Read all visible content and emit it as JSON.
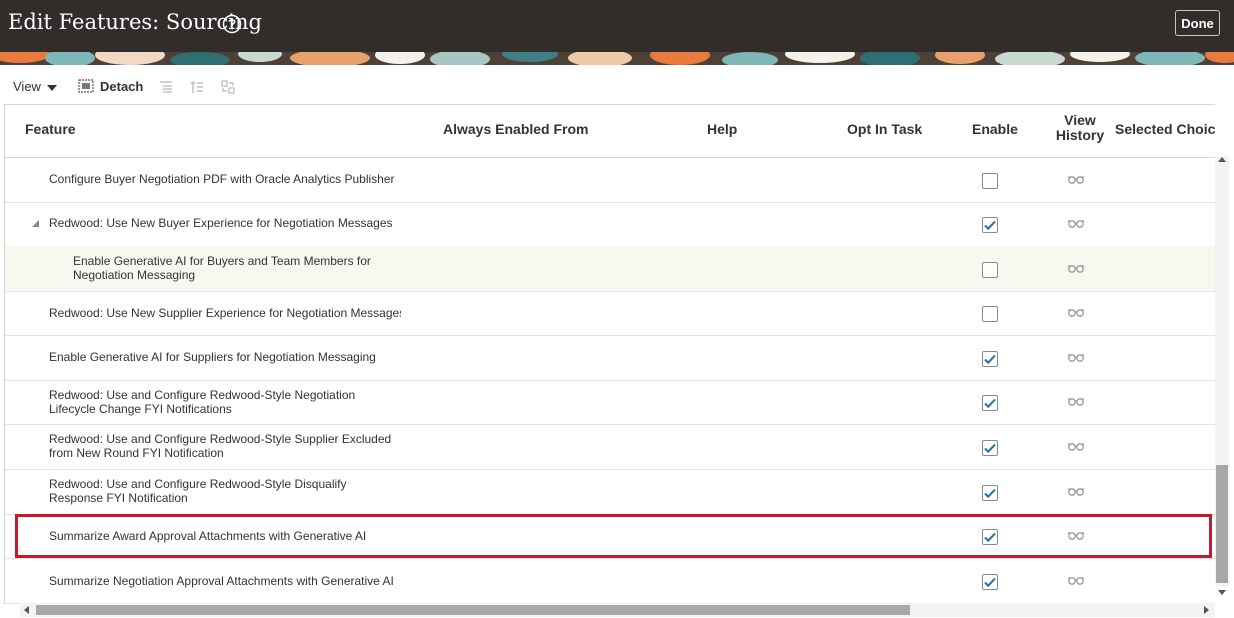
{
  "header": {
    "title": "Edit Features: Sourcing",
    "done_label": "Done"
  },
  "toolbar": {
    "view_label": "View",
    "detach_label": "Detach"
  },
  "table": {
    "columns": [
      "Feature",
      "Always Enabled From",
      "Help",
      "Opt In Task",
      "Enable",
      "View History",
      "Selected Choice"
    ],
    "rows": [
      {
        "feature": "Configure Buyer Negotiation PDF with Oracle Analytics Publisher",
        "enabled": false
      },
      {
        "feature": "Redwood: Use New Buyer Experience for Negotiation Messages",
        "enabled": true,
        "expanded": true
      },
      {
        "feature": "Enable Generative AI for Buyers and Team Members for Negotiation Messaging",
        "enabled": false,
        "child": true
      },
      {
        "feature": "Redwood: Use New Supplier Experience for Negotiation Messages",
        "enabled": false
      },
      {
        "feature": "Enable Generative AI for Suppliers for Negotiation Messaging",
        "enabled": true
      },
      {
        "feature": "Redwood: Use and Configure Redwood-Style Negotiation Lifecycle Change FYI Notifications",
        "enabled": true
      },
      {
        "feature": "Redwood: Use and Configure Redwood-Style Supplier Excluded from New Round FYI Notification",
        "enabled": true
      },
      {
        "feature": "Redwood: Use and Configure Redwood-Style Disqualify Response FYI Notification",
        "enabled": true
      },
      {
        "feature": "Summarize Award Approval Attachments with Generative AI",
        "enabled": true,
        "highlighted": true
      },
      {
        "feature": "Summarize Negotiation Approval Attachments with Generative AI",
        "enabled": true
      }
    ]
  },
  "colors": {
    "header_bg": "#312d2a",
    "highlight": "#c41c2c",
    "check": "#1f6fa8"
  },
  "icons": {
    "help": "question-circle-icon",
    "detach": "detach-icon",
    "view_history": "glasses-icon"
  }
}
